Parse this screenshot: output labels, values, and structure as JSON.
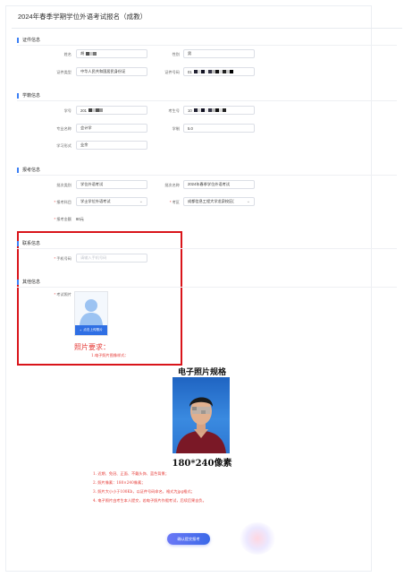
{
  "page": {
    "title": "2024年春季学期学位外语考试报名（成教）",
    "submit_label": "确认提交报考"
  },
  "sections": {
    "id_info": "证件信息",
    "student_info": "学籍信息",
    "exam_info": "报考信息",
    "contact_info": "联系信息",
    "other_info": "其他信息"
  },
  "id_info": {
    "name_label": "姓名",
    "name_value": "胡",
    "gender_label": "性别",
    "gender_value": "男",
    "doc_type_label": "证件类型",
    "doc_type_value": "中华人民共和国居民身份证",
    "doc_no_label": "证件号码",
    "doc_no_value": "01"
  },
  "student_info": {
    "student_id_label": "学号",
    "student_id_value": "201",
    "exam_no_label": "考生号",
    "exam_no_value": "10",
    "major_label": "专业名称",
    "major_value": "会计学",
    "duration_label": "学制",
    "duration_value": "5.0",
    "study_mode_label": "学习形式",
    "study_mode_value": "业余"
  },
  "exam_info": {
    "batch_type_label": "批次类别",
    "batch_type_value": "学位外语考试",
    "batch_name_label": "批次名称",
    "batch_name_value": "2024年春季学位外语考试",
    "subject_label": "报考科目",
    "subject_value": "学士学位外语考试",
    "campus_label": "考区",
    "campus_value": "成都信息工程大学龙泉校区(",
    "fee_label": "报考金额",
    "fee_value": "80元"
  },
  "contact_info": {
    "phone_label": "手机号码",
    "phone_placeholder": "请输入手机号码"
  },
  "other_info": {
    "photo_label": "考试照片",
    "upload_label": "点击上传照片",
    "requirement_title": "照片要求：",
    "requirement_item": "1.电子照片图像样式："
  },
  "photo_spec": {
    "title": "电子照片规格",
    "size_label": "180*240像素",
    "rules": [
      "1. 近期、免冠、正面、不戴头饰、蓝色背景；",
      "2. 照片像素：180×240像素；",
      "3. 照片大小小于100Kb，以证件号码命名，格式为jpg格式；",
      "4. 电子照片由考生本人提交，若电子照片作假考试，后续后果自负。"
    ]
  },
  "colors": {
    "accent": "#3b7ff5",
    "highlight_box": "#d9141a",
    "requirement_text": "#e53935",
    "upload_button": "#2f6fe4"
  }
}
